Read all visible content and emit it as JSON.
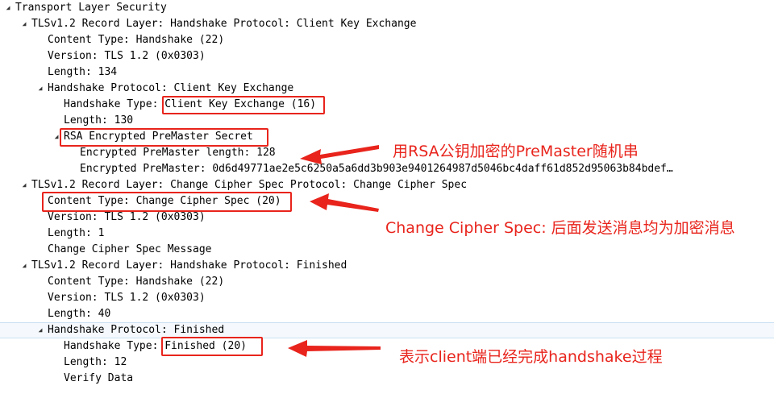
{
  "tree": {
    "transport_layer": "Transport Layer Security",
    "record1": {
      "title": "TLSv1.2 Record Layer: Handshake Protocol: Client Key Exchange",
      "content_type": "Content Type: Handshake (22)",
      "version": "Version: TLS 1.2 (0x0303)",
      "length": "Length: 134",
      "handshake": {
        "title": "Handshake Protocol: Client Key Exchange",
        "type_prefix": "Handshake Type: ",
        "type_value": "Client Key Exchange (16)",
        "length": "Length: 130",
        "rsa": {
          "title": "RSA Encrypted PreMaster Secret",
          "pm_length": "Encrypted PreMaster length: 128",
          "pm": "Encrypted PreMaster: 0d6d49771ae2e5c6250a5a6dd3b903e9401264987d5046bc4daff61d852d95063b84bdef…"
        }
      }
    },
    "record2": {
      "title": "TLSv1.2 Record Layer: Change Cipher Spec Protocol: Change Cipher Spec",
      "content_type": "Content Type: Change Cipher Spec (20)",
      "version": "Version: TLS 1.2 (0x0303)",
      "length": "Length: 1",
      "message": "Change Cipher Spec Message"
    },
    "record3": {
      "title": "TLSv1.2 Record Layer: Handshake Protocol: Finished",
      "content_type": "Content Type: Handshake (22)",
      "version": "Version: TLS 1.2 (0x0303)",
      "length": "Length: 40",
      "handshake": {
        "title": "Handshake Protocol: Finished",
        "type_prefix": "Handshake Type: ",
        "type_value": "Finished (20)",
        "length": "Length: 12",
        "verify": "Verify Data"
      }
    }
  },
  "annotations": {
    "premaster_note": "用RSA公钥加密的PreMaster随机串",
    "ccs_note": "Change Cipher Spec: 后面发送消息均为加密消息",
    "finished_note": "表示client端已经完成handshake过程"
  },
  "colors": {
    "annotation_red": "#e8241c",
    "selection_bg": "#f5f9fd"
  }
}
